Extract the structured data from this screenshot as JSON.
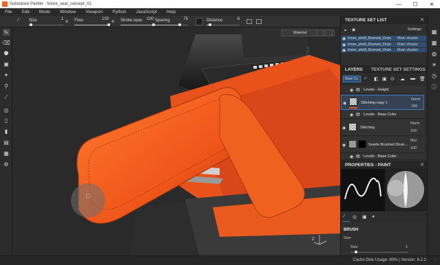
{
  "window": {
    "title": "Substance Painter - future_seat_concept_02",
    "minimize": "—",
    "maximize": "☐",
    "close": "✕"
  },
  "menu": [
    "File",
    "Edit",
    "Mode",
    "Window",
    "Viewport",
    "Python",
    "JavaScript",
    "Help"
  ],
  "toolbar": {
    "size_label": "Size",
    "size_value": "1",
    "size_fraction": 0.05,
    "flow_label": "Flow",
    "flow_value": "100",
    "flow_fraction": 1.0,
    "stroke_label": "Stroke opac",
    "stroke_value": "100",
    "stroke_fraction": 1.0,
    "spacing_label": "Spacing",
    "spacing_value": "75",
    "spacing_fraction": 0.75,
    "distance_label": "Distance",
    "distance_value": "6",
    "distance_fraction": 0.1
  },
  "viewport": {
    "material_dropdown": "Material",
    "axis_label": "Z"
  },
  "texture_set_list": {
    "header": "TEXTURE SET LIST",
    "settings": "Settings",
    "rows": [
      {
        "name": "Inner_shell_Burned_Oran",
        "shader": "Main shader"
      },
      {
        "name": "Inner_shell_Burned_Oran",
        "shader": "Main shader"
      },
      {
        "name": "Inner_shell_Burned_Oran",
        "shader": "Main shader"
      }
    ]
  },
  "layers_panel": {
    "tab_layers": "LAYERS",
    "tab_texture_settings": "TEXTURE SET SETTINGS",
    "channel": "Base Co",
    "layers": [
      {
        "name": "Levels - Height"
      },
      {
        "name": "Stitching copy 1",
        "blend": "Norm",
        "opacity": "100"
      },
      {
        "name": "Levels - Base Color"
      },
      {
        "name": "Stitching",
        "blend": "Norm",
        "opacity": "100"
      },
      {
        "name": "Suede Brushed Dove...",
        "blend": "Mul",
        "opacity": "100"
      },
      {
        "name": "Levels - Base Color"
      }
    ]
  },
  "properties": {
    "header": "PROPERTIES - PAINT",
    "brush_label": "BRUSH",
    "size_label": "Size",
    "size_sub": "Size",
    "size_value": "1"
  },
  "status": {
    "text": "Cache Disk Usage: 80% | Version: 6.2.2"
  }
}
